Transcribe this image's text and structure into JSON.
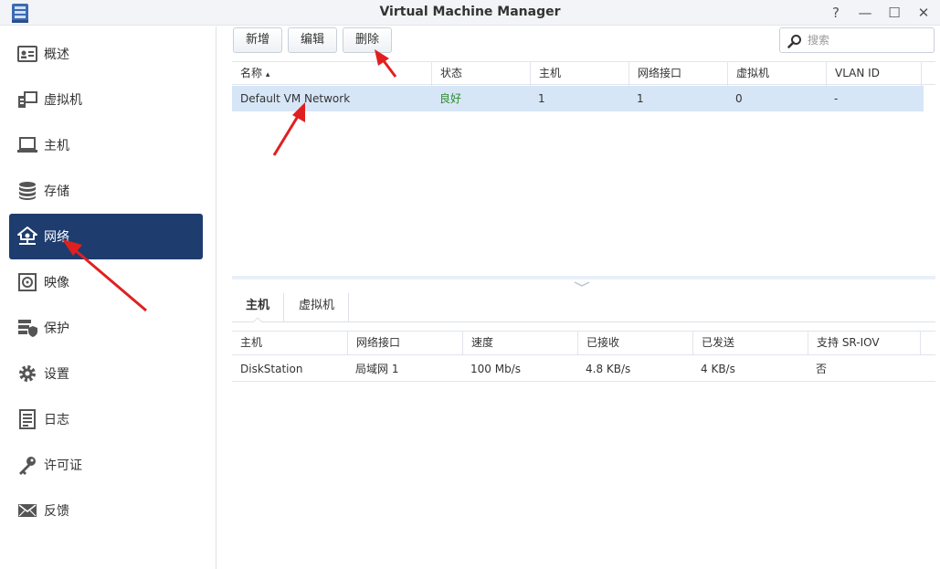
{
  "window": {
    "title": "Virtual Machine Manager",
    "help_glyph": "?",
    "minimize_glyph": "—",
    "maximize_glyph": "☐",
    "close_glyph": "✕"
  },
  "sidebar": {
    "items": [
      {
        "label": "概述",
        "icon": "overview-icon"
      },
      {
        "label": "虚拟机",
        "icon": "virtual-machine-icon"
      },
      {
        "label": "主机",
        "icon": "host-icon"
      },
      {
        "label": "存储",
        "icon": "storage-icon"
      },
      {
        "label": "网络",
        "icon": "network-icon",
        "active": true
      },
      {
        "label": "映像",
        "icon": "image-icon"
      },
      {
        "label": "保护",
        "icon": "protection-icon"
      },
      {
        "label": "设置",
        "icon": "settings-icon"
      },
      {
        "label": "日志",
        "icon": "log-icon"
      },
      {
        "label": "许可证",
        "icon": "license-icon"
      },
      {
        "label": "反馈",
        "icon": "feedback-icon"
      }
    ]
  },
  "toolbar": {
    "add_label": "新增",
    "edit_label": "编辑",
    "delete_label": "删除",
    "search_placeholder": "搜索"
  },
  "networks_table": {
    "columns": [
      "名称",
      "状态",
      "主机",
      "网络接口",
      "虚拟机",
      "VLAN ID"
    ],
    "sort_glyph": "▴",
    "rows": [
      {
        "name": "Default VM Network",
        "status": "良好",
        "hosts": "1",
        "interfaces": "1",
        "vms": "0",
        "vlan": "-"
      }
    ]
  },
  "detail_tabs": {
    "host_label": "主机",
    "vm_label": "虚拟机"
  },
  "hosts_table": {
    "columns": [
      "主机",
      "网络接口",
      "速度",
      "已接收",
      "已发送",
      "支持 SR-IOV"
    ],
    "rows": [
      {
        "host": "DiskStation",
        "interface": "局域网 1",
        "speed": "100 Mb/s",
        "received": "4.8 KB/s",
        "sent": "4 KB/s",
        "sriov": "否"
      }
    ]
  },
  "colors": {
    "active_nav": "#1e3c6e",
    "selected_row": "#d6e6f7",
    "status_good": "#2e8b2e",
    "annotation_arrow": "#e02020"
  }
}
